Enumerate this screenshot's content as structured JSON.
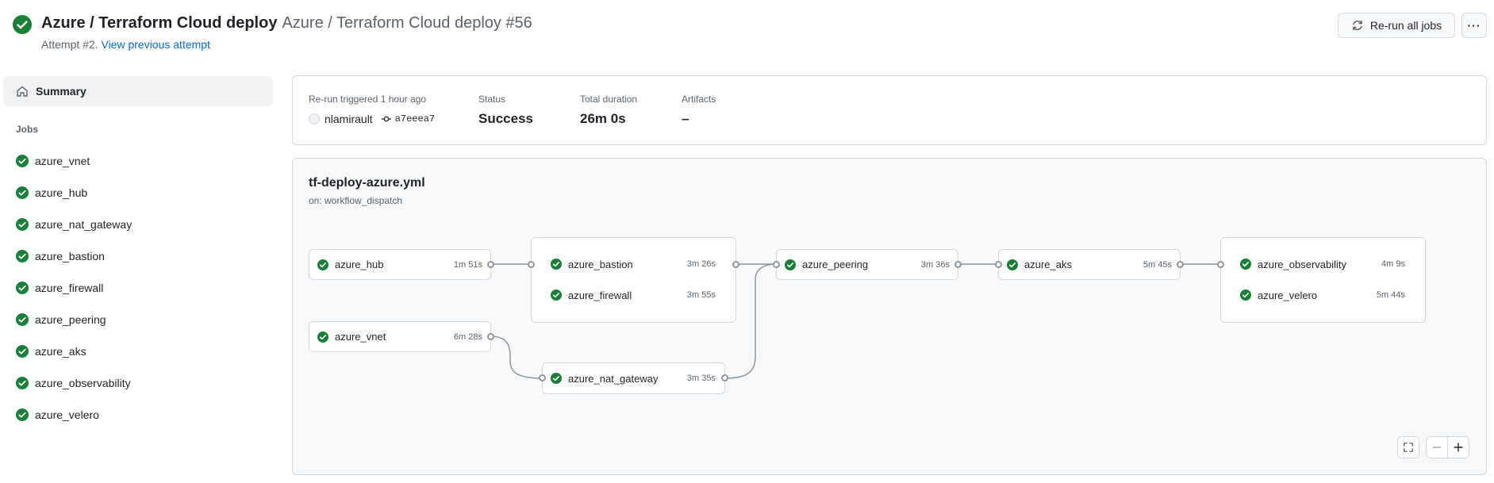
{
  "header": {
    "workflow_name": "Azure / Terraform Cloud deploy",
    "run_title": "Azure / Terraform Cloud deploy #56",
    "attempt_text": "Attempt #2.",
    "view_previous": "View previous attempt",
    "rerun_label": "Re-run all jobs",
    "more_label": "···"
  },
  "sidebar": {
    "summary_label": "Summary",
    "jobs_heading": "Jobs",
    "jobs": [
      {
        "label": "azure_vnet"
      },
      {
        "label": "azure_hub"
      },
      {
        "label": "azure_nat_gateway"
      },
      {
        "label": "azure_bastion"
      },
      {
        "label": "azure_firewall"
      },
      {
        "label": "azure_peering"
      },
      {
        "label": "azure_aks"
      },
      {
        "label": "azure_observability"
      },
      {
        "label": "azure_velero"
      }
    ]
  },
  "summary": {
    "trigger_label": "Re-run triggered 1 hour ago",
    "user": "nlamirault",
    "commit": "a7eeea7",
    "status_label": "Status",
    "status_value": "Success",
    "duration_label": "Total duration",
    "duration_value": "26m 0s",
    "artifacts_label": "Artifacts",
    "artifacts_value": "–"
  },
  "graph": {
    "file": "tf-deploy-azure.yml",
    "trigger": "on: workflow_dispatch",
    "jobs": {
      "hub": {
        "name": "azure_hub",
        "duration": "1m 51s"
      },
      "vnet": {
        "name": "azure_vnet",
        "duration": "6m 28s"
      },
      "bastion": {
        "name": "azure_bastion",
        "duration": "3m 26s"
      },
      "firewall": {
        "name": "azure_firewall",
        "duration": "3m 55s"
      },
      "nat_gateway": {
        "name": "azure_nat_gateway",
        "duration": "3m 35s"
      },
      "peering": {
        "name": "azure_peering",
        "duration": "3m 36s"
      },
      "aks": {
        "name": "azure_aks",
        "duration": "5m 45s"
      },
      "observability": {
        "name": "azure_observability",
        "duration": "4m 9s"
      },
      "velero": {
        "name": "azure_velero",
        "duration": "5m 44s"
      }
    }
  },
  "icons": {
    "success": "check-circle-icon",
    "home": "home-icon",
    "sync": "sync-icon",
    "commit": "git-commit-icon",
    "fullscreen": "screen-full-icon",
    "zoom_out": "dash-icon",
    "zoom_in": "plus-icon"
  },
  "colors": {
    "success": "#1a7f37",
    "link": "#0969da",
    "muted": "#59636e",
    "border": "#d1d9e0",
    "canvas": "#f6f8fa"
  }
}
